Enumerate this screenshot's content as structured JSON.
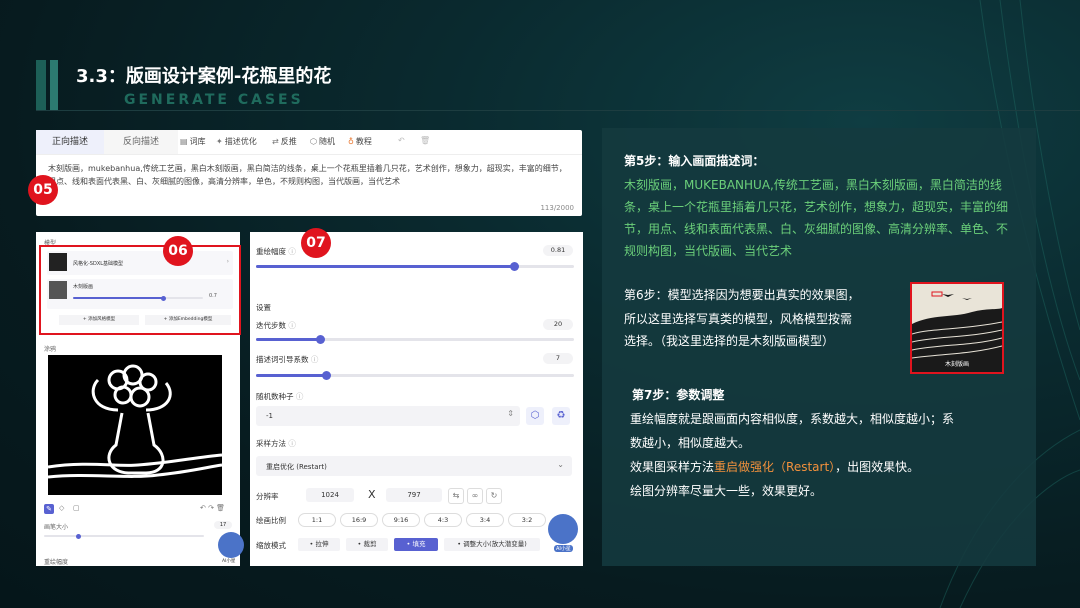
{
  "header": {
    "title": "3.3：版画设计案例-花瓶里的花",
    "subtitle": "GENERATE CASES"
  },
  "prompt_panel": {
    "tab_positive": "正向描述",
    "tab_negative": "反向描述",
    "tools": [
      {
        "icon": "book-icon",
        "label": "词库"
      },
      {
        "icon": "magic-icon",
        "label": "描述优化"
      },
      {
        "icon": "swap-icon",
        "label": "反推"
      },
      {
        "icon": "dice-icon",
        "label": "随机"
      },
      {
        "icon": "bulb-icon",
        "label": "教程"
      }
    ],
    "prompt_text": "木刻版画，mukebanhua,传统工艺画，黑白木刻版画，黑白简洁的线条，桌上一个花瓶里插着几只花，艺术创作，想象力，超现实，丰富的细节，用点、线和表面代表黑、白、灰细腻的图像，高清分辨率，单色，不规则构图，当代版画，当代艺术",
    "counter": "113/2000"
  },
  "badges": {
    "b05": "05",
    "b06": "06",
    "b07": "07"
  },
  "left_panel": {
    "model_label": "模型",
    "base_model": "风格化-SDXL基础模型",
    "style_model": "木刻版画",
    "style_weight": "0.7",
    "add_style_btn": "+ 添加风格模型",
    "add_embed_btn": "+ 添加Embedding模型",
    "canvas_label": "涂鸦",
    "brush_label": "画笔大小",
    "brush_value": "17",
    "redraw_label": "重绘幅度",
    "ai_label": "AI小星"
  },
  "settings": {
    "redraw_label": "重绘幅度",
    "redraw_value": "0.81",
    "redraw_fraction": 0.81,
    "section_label": "设置",
    "steps_label": "迭代步数",
    "steps_value": "20",
    "steps_fraction": 0.2,
    "cfg_label": "描述词引导系数",
    "cfg_value": "7",
    "cfg_fraction": 0.22,
    "seed_label": "随机数种子",
    "seed_value": "-1",
    "sampler_label": "采样方法",
    "sampler_value": "重启优化 (Restart)",
    "resolution_label": "分辨率",
    "width": "1024",
    "x_sep": "X",
    "height": "797",
    "ratio_label": "绘画比例",
    "ratios": [
      "1:1",
      "16:9",
      "9:16",
      "4:3",
      "3:4",
      "3:2"
    ],
    "scale_label": "缩放模式",
    "modes": [
      "拉伸",
      "裁剪",
      "填充",
      "调整大小(放大潜变量)"
    ],
    "ai_label": "AI小星"
  },
  "description": {
    "step5_title": "第5步：输入画面描述词：",
    "step5_text": "木刻版画，MUKEBANHUA,传统工艺画，黑白木刻版画，黑白简洁的线条，桌上一个花瓶里插着几只花，艺术创作，想象力，超现实，丰富的细节，用点、线和表面代表黑、白、灰细腻的图像、高清分辨率、单色、不规则构图，当代版画、当代艺术",
    "step6_line1": "第6步：模型选择因为想要出真实的效果图，",
    "step6_line2": "所以这里选择写真类的模型，风格模型按需",
    "step6_line3": "选择。（我这里选择的是木刻版画模型）",
    "thumb_caption": "木刻版画",
    "step7_title": "第7步：参数调整",
    "step7_line1": "重绘幅度就是跟画面内容相似度，系数越大，相似度越小；系",
    "step7_line2": "数越小，相似度越大。",
    "step7_line3a": "效果图采样方法",
    "step7_line3b": "重启做强化（Restart）",
    "step7_line3c": "，出图效果快。",
    "step7_line4": "绘图分辨率尽量大一些，效果更好。"
  }
}
